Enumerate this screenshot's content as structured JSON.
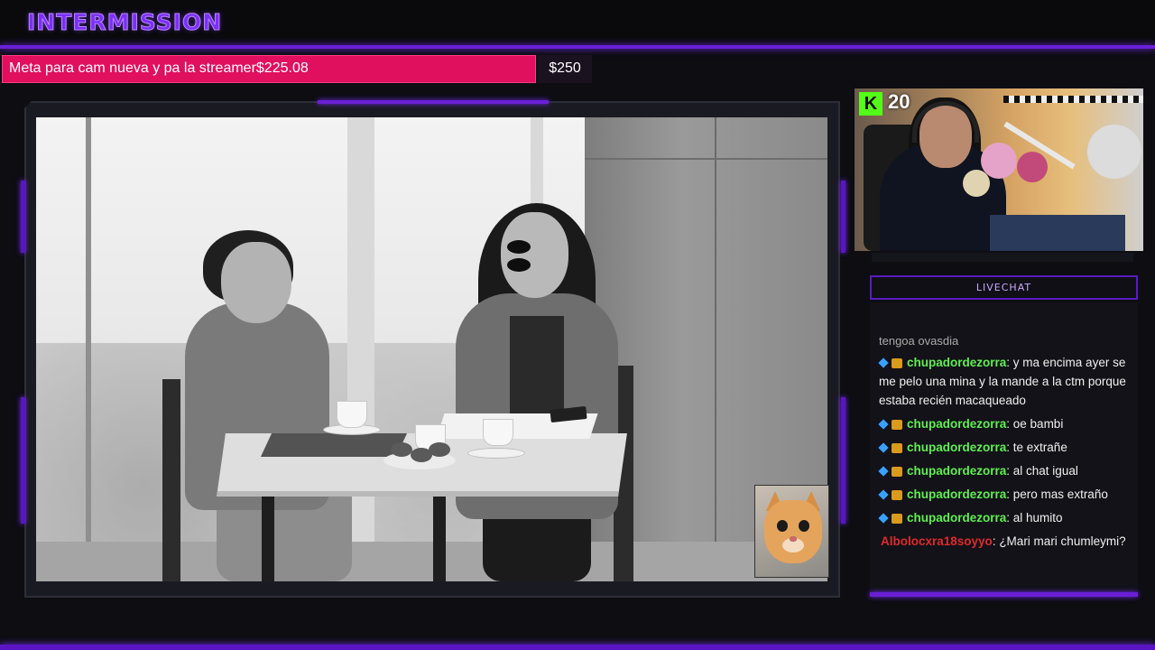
{
  "header": {
    "title": "INTERMISSION"
  },
  "goal": {
    "label": "Meta para cam nueva y pa la streamer$225.08",
    "target": "$250",
    "bar_color": "#e0105e"
  },
  "webcam": {
    "viewer_count": "20",
    "platform_icon": "kick-icon",
    "platform_badge": "K"
  },
  "chat": {
    "header": "LIVECHAT",
    "cut_line": "tengoa ovasdia",
    "messages": [
      {
        "user": "chupadordezorra",
        "text": ": y ma encima ayer se me pelo una mina y la mande a la ctm porque estaba recién macaqueado",
        "color": "green"
      },
      {
        "user": "chupadordezorra",
        "text": ": oe bambi",
        "color": "green"
      },
      {
        "user": "chupadordezorra",
        "text": ": te extrañe",
        "color": "green"
      },
      {
        "user": "chupadordezorra",
        "text": ": al chat igual",
        "color": "green"
      },
      {
        "user": "chupadordezorra",
        "text": ": pero mas extraño",
        "color": "green"
      },
      {
        "user": "chupadordezorra",
        "text": ": al humito",
        "color": "green"
      },
      {
        "user": "Albolocxra18soyyo",
        "text": ": ¿Mari mari chumleymi?",
        "color": "red"
      }
    ]
  },
  "colors": {
    "accent": "#6a1fd6",
    "goal": "#e0105e",
    "kick_green": "#53fc18"
  }
}
